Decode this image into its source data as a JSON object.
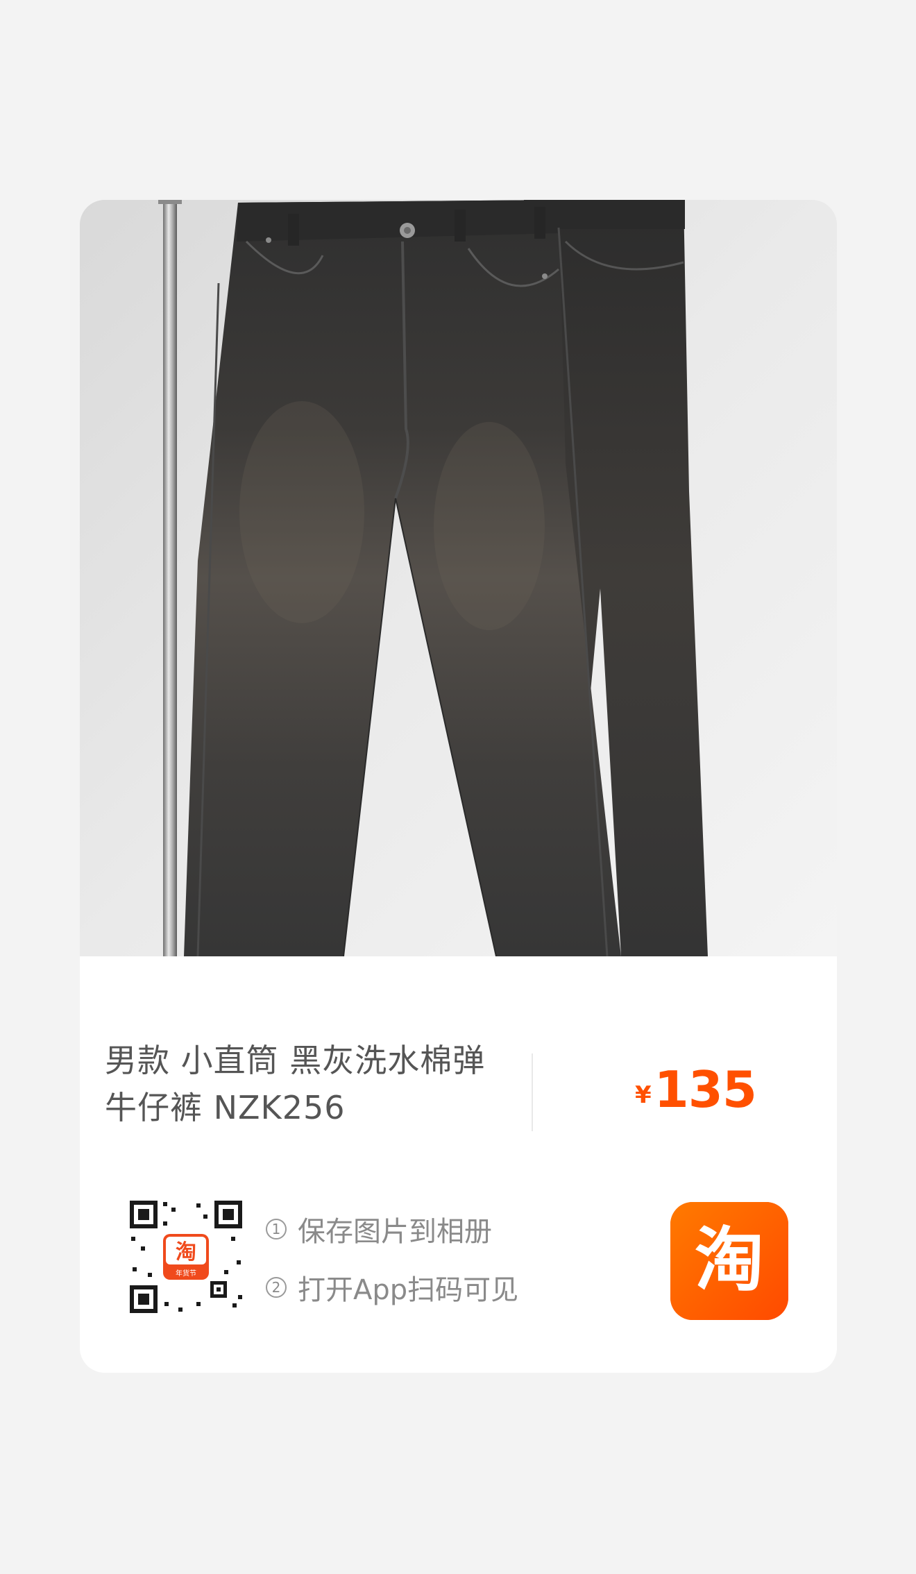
{
  "product": {
    "title": "男款 小直筒 黑灰洗水棉弹牛仔裤 NZK256",
    "price_currency": "¥",
    "price_amount": "135",
    "image_icon": "product-photo-jeans"
  },
  "share": {
    "qr_icon": "qr-code-icon",
    "qr_center_text": "淘",
    "qr_center_sub": "年货节",
    "steps": [
      {
        "num": "1",
        "text": "保存图片到相册"
      },
      {
        "num": "2",
        "text": "打开App扫码可见"
      }
    ],
    "app_icon": "taobao-app-icon",
    "app_icon_text": "淘"
  },
  "colors": {
    "price": "#ff5000",
    "app_icon_bg": "#ff5a00",
    "card_bg": "#ffffff",
    "page_bg": "#f3f3f3"
  }
}
